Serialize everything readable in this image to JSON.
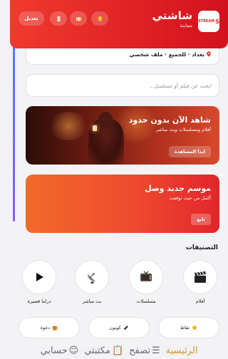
{
  "app": {
    "name": "شاشتي",
    "subtitle": "مماينة",
    "logo_text": "STREAM"
  },
  "header": {
    "edit_label": "تعديل",
    "icons": [
      "phone-icon",
      "film-icon",
      "bell-icon"
    ],
    "accent": "#e3262c"
  },
  "location": {
    "text": "بغداد · للجميع · ملف شخصي",
    "icon": "pin-icon"
  },
  "search": {
    "placeholder": "ابحث عن فيلم أو مسلسل..."
  },
  "hero": {
    "title": "شاهد الآن بدون حدود",
    "subtitle": "أفلام ومسلسلات وبث مباشر",
    "button": "ابدأ المشاهدة"
  },
  "promo": {
    "title": "موسم جديد وصل",
    "subtitle": "أكمل من حيث توقفت",
    "button": "تابع"
  },
  "categories": {
    "title": "التصنيفات",
    "items": [
      {
        "label": "أفلام",
        "icon": "clapperboard-icon"
      },
      {
        "label": "مسلسلات",
        "icon": "tv-icon"
      },
      {
        "label": "بث مباشر",
        "icon": "satellite-dish-icon"
      },
      {
        "label": "دراما قصيرة",
        "icon": "play-icon"
      }
    ]
  },
  "pills": [
    {
      "label": "نقاط",
      "icon": "star-icon"
    },
    {
      "label": "كوبون",
      "icon": "ticket-icon"
    },
    {
      "label": "دعوة",
      "icon": "gift-icon"
    }
  ],
  "tabbar": {
    "items": [
      {
        "label": "الرئيسية",
        "glyph": "",
        "active": true
      },
      {
        "label": "تصفح",
        "glyph": "☰",
        "active": false
      },
      {
        "label": "مكتبتي",
        "glyph": "📋",
        "active": false
      },
      {
        "label": "حسابي",
        "glyph": "☺",
        "active": false
      }
    ]
  },
  "colors": {
    "primary": "#e3262c",
    "orange": "#f26a2a",
    "active_tab": "#c99a2e"
  }
}
